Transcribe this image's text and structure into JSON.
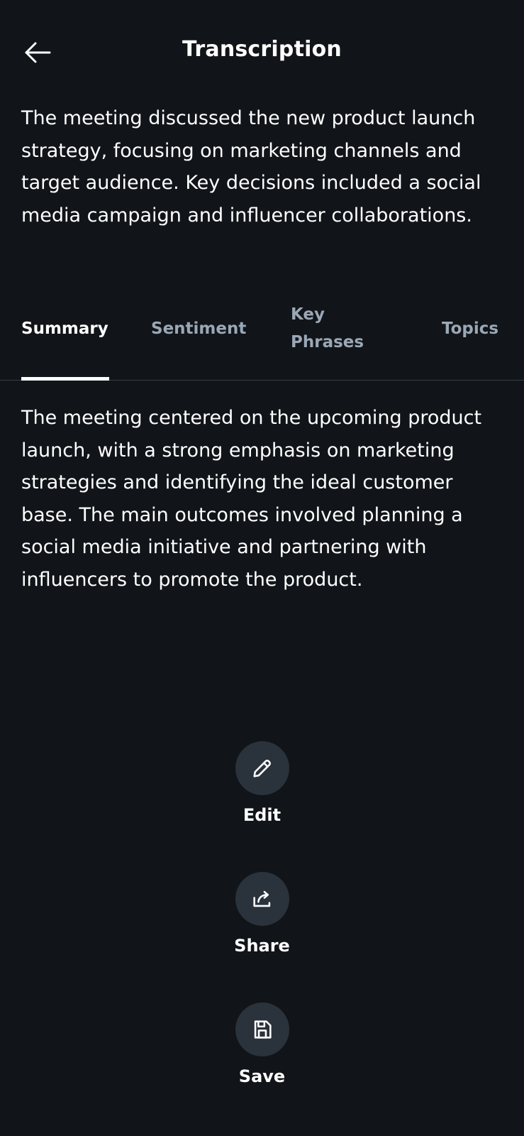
{
  "header": {
    "title": "Transcription",
    "back_icon": "arrow-left-icon"
  },
  "intro": {
    "text": "The meeting discussed the new product launch strategy, focusing on marketing channels and target audience. Key decisions included a social media campaign and influencer collaborations."
  },
  "tabs": [
    {
      "label": "Summary",
      "active": true
    },
    {
      "label": "Sentiment",
      "active": false
    },
    {
      "label": "Key Phrases",
      "active": false
    },
    {
      "label": "Topics",
      "active": false
    }
  ],
  "summary": {
    "text": "The meeting centered on the upcoming product launch, with a strong emphasis on marketing strategies and identifying the ideal customer base. The main outcomes involved planning a social media initiative and partnering with influencers to promote the product."
  },
  "actions": [
    {
      "label": "Edit",
      "icon": "pencil-icon"
    },
    {
      "label": "Share",
      "icon": "share-icon"
    },
    {
      "label": "Save",
      "icon": "floppy-disk-icon"
    }
  ],
  "colors": {
    "background": "#111418",
    "text": "#ffffff",
    "inactive_tab": "#9aa7b6",
    "action_circle": "#2a323c",
    "divider": "#3a414b"
  }
}
